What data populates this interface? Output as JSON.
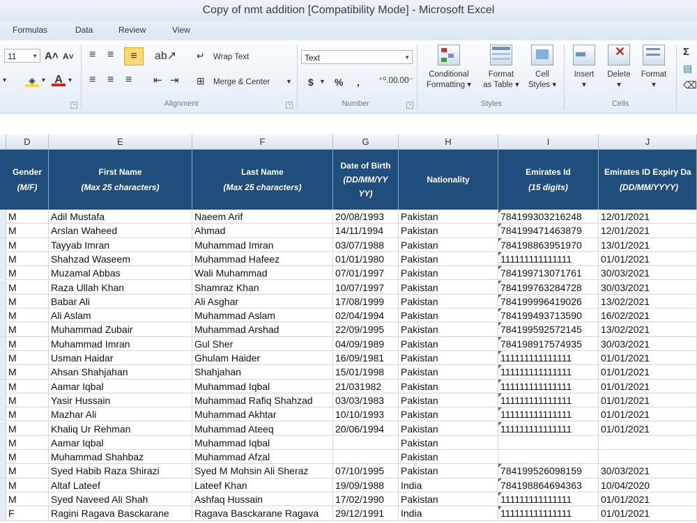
{
  "window": {
    "title": "Copy of nmt addition  [Compatibility Mode]  -  Microsoft Excel"
  },
  "ribbon_tabs": [
    "Formulas",
    "Data",
    "Review",
    "View"
  ],
  "ribbon": {
    "font_size": "11",
    "wrap_text": "Wrap Text",
    "merge_center": "Merge & Center",
    "number_format": "Text",
    "currency": "$",
    "percent": "%",
    "comma": ",",
    "conditional_formatting": [
      "Conditional",
      "Formatting"
    ],
    "format_as_table": [
      "Format",
      "as Table"
    ],
    "cell_styles": [
      "Cell",
      "Styles"
    ],
    "insert": "Insert",
    "delete": "Delete",
    "format": "Format",
    "group_alignment": "Alignment",
    "group_number": "Number",
    "group_styles": "Styles",
    "group_cells": "Cells",
    "sigma": "Σ"
  },
  "columns": [
    "D",
    "E",
    "F",
    "G",
    "H",
    "I",
    "J"
  ],
  "headers": [
    {
      "title": "Gender",
      "sub": "(M/F)"
    },
    {
      "title": "First Name",
      "sub": "(Max 25 characters)"
    },
    {
      "title": "Last Name",
      "sub": "(Max 25 characters)"
    },
    {
      "title": "Date of Birth",
      "sub": "(DD/MM/YY YY)"
    },
    {
      "title": "Nationality",
      "sub": ""
    },
    {
      "title": "Emirates Id",
      "sub": "(15 digits)"
    },
    {
      "title": "Emirates ID Expiry Da",
      "sub": "(DD/MM/YYYY)"
    }
  ],
  "rows": [
    [
      "M",
      "Adil Mustafa",
      "Naeem Arif",
      "20/08/1993",
      "Pakistan",
      "784199303216248",
      "12/01/2021"
    ],
    [
      "M",
      "Arslan Waheed",
      "Ahmad",
      "14/11/1994",
      "Pakistan",
      "784199471463879",
      "12/01/2021"
    ],
    [
      "M",
      "Tayyab Imran",
      "Muhammad Imran",
      "03/07/1988",
      "Pakistan",
      "784198863951970",
      "13/01/2021"
    ],
    [
      "M",
      "Shahzad Waseem",
      "Muhammad Hafeez",
      "01/01/1980",
      "Pakistan",
      "111111111111111",
      "01/01/2021"
    ],
    [
      "M",
      "Muzamal Abbas",
      "Wali Muhammad",
      "07/01/1997",
      "Pakistan",
      "784199713071761",
      "30/03/2021"
    ],
    [
      "M",
      "Raza Ullah Khan",
      "Shamraz Khan",
      "10/07/1997",
      "Pakistan",
      "784199763284728",
      "30/03/2021"
    ],
    [
      "M",
      "Babar Ali",
      "Ali Asghar",
      "17/08/1999",
      "Pakistan",
      "784199996419026",
      "13/02/2021"
    ],
    [
      "M",
      "Ali Aslam",
      "Muhammad Aslam",
      "02/04/1994",
      "Pakistan",
      "784199493713590",
      "16/02/2021"
    ],
    [
      "M",
      "Muhammad Zubair",
      "Muhammad Arshad",
      "22/09/1995",
      "Pakistan",
      "784199592572145",
      "13/02/2021"
    ],
    [
      "M",
      "Muhammad Imran",
      "Gul Sher",
      "04/09/1989",
      "Pakistan",
      "784198917574935",
      "30/03/2021"
    ],
    [
      "M",
      "Usman Haidar",
      "Ghulam Haider",
      "16/09/1981",
      "Pakistan",
      "111111111111111",
      "01/01/2021"
    ],
    [
      "M",
      "Ahsan Shahjahan",
      "Shahjahan",
      "15/01/1998",
      "Pakistan",
      "111111111111111",
      "01/01/2021"
    ],
    [
      "M",
      "Aamar Iqbal",
      "Muhammad Iqbal",
      "21/031982",
      "Pakistan",
      "111111111111111",
      "01/01/2021"
    ],
    [
      "M",
      "Yasir Hussain",
      "Muhammad Rafiq Shahzad",
      "03/03/1983",
      "Pakistan",
      "111111111111111",
      "01/01/2021"
    ],
    [
      "M",
      "Mazhar Ali",
      "Muhammad Akhtar",
      "10/10/1993",
      "Pakistan",
      "111111111111111",
      "01/01/2021"
    ],
    [
      "M",
      "Khaliq Ur Rehman",
      "Muhammad Ateeq",
      "20/06/1994",
      "Pakistan",
      "111111111111111",
      "01/01/2021"
    ],
    [
      "M",
      "Aamar Iqbal",
      "Muhammad Iqbal",
      "",
      "Pakistan",
      "",
      ""
    ],
    [
      "M",
      "Muhammad Shahbaz",
      "Muhammad Afzal",
      "",
      "Pakistan",
      "",
      ""
    ],
    [
      "M",
      "Syed Habib Raza Shirazi",
      "Syed M Mohsin Ali Sheraz",
      "07/10/1995",
      "Pakistan",
      "784199526098159",
      "30/03/2021"
    ],
    [
      "M",
      "Altaf Lateef",
      "Lateef Khan",
      "19/09/1988",
      "India",
      "784198864694363",
      "10/04/2020"
    ],
    [
      "M",
      "Syed Naveed Ali Shah",
      "Ashfaq Hussain",
      "17/02/1990",
      "Pakistan",
      "111111111111111",
      "01/01/2021"
    ],
    [
      "F",
      "Ragini Ragava Basckarane",
      "Ragava Basckarane Ragava",
      "29/12/1991",
      "India",
      "111111111111111",
      "01/01/2021"
    ]
  ]
}
